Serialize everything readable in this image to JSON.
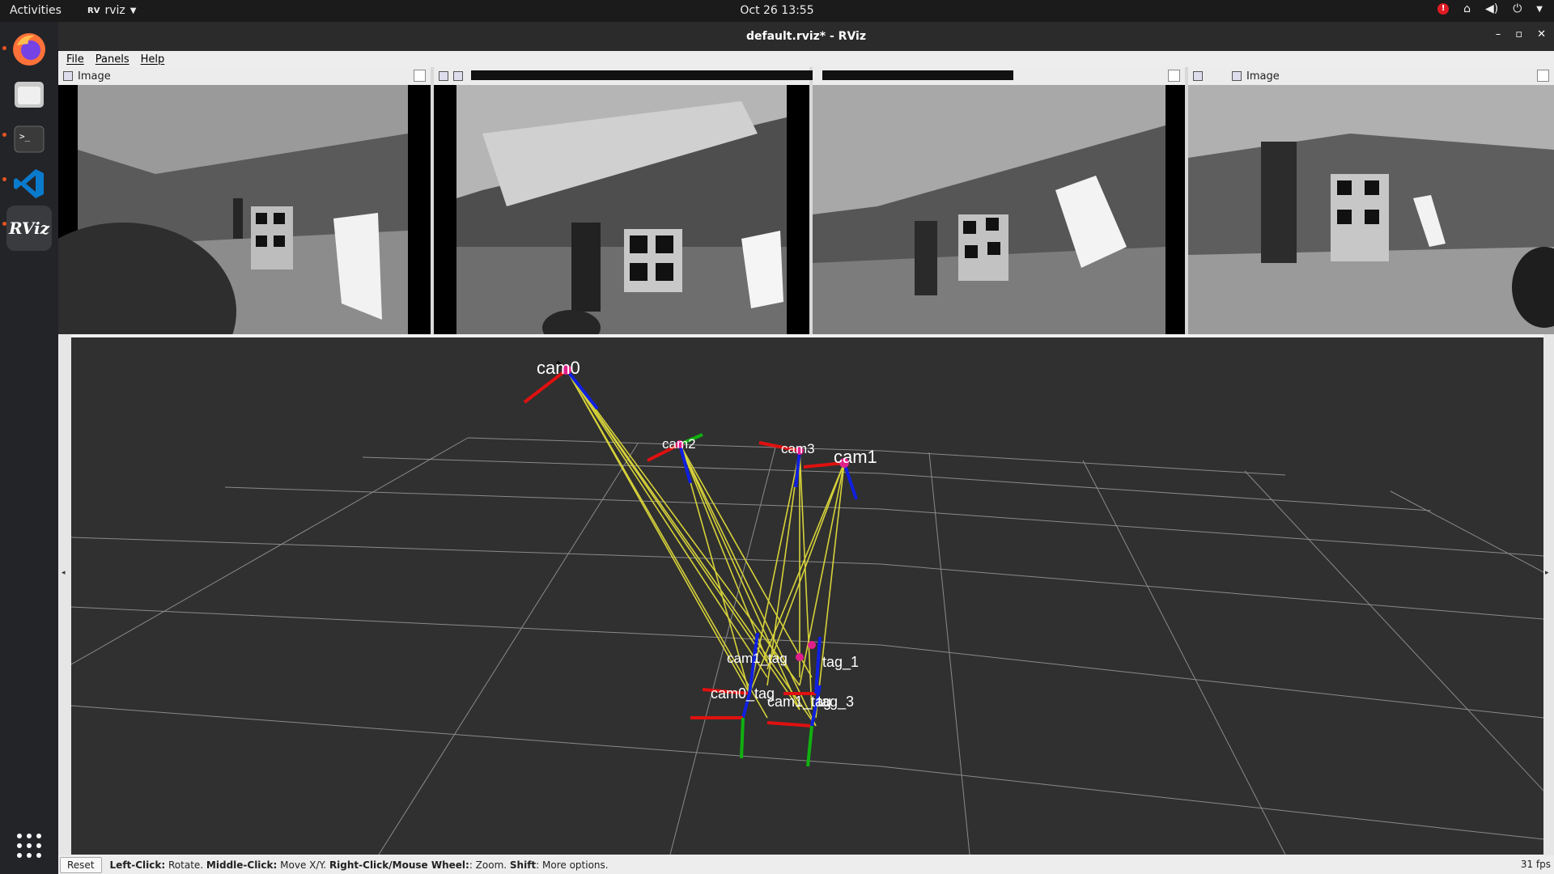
{
  "topbar": {
    "activities": "Activities",
    "app_name": "rviz",
    "clock": "Oct 26  13:55"
  },
  "window": {
    "title": "default.rviz* - RViz"
  },
  "menu": {
    "file": "File",
    "panels": "Panels",
    "help": "Help"
  },
  "image_panels": [
    {
      "title": "Image"
    },
    {
      "title": ""
    },
    {
      "title": ""
    },
    {
      "title": "Image"
    }
  ],
  "viewport": {
    "labels": {
      "cam0": "cam0",
      "cam1": "cam1",
      "cam2": "cam2",
      "cam3": "cam3",
      "tag_1": "tag_1",
      "tag_3": "tag_3",
      "cam0_tag": "cam0_tag",
      "cam1_tag": "cam1_tag"
    }
  },
  "statusbar": {
    "reset": "Reset",
    "hint_left_key": "Left-Click:",
    "hint_left": " Rotate. ",
    "hint_middle_key": "Middle-Click:",
    "hint_middle": " Move X/Y. ",
    "hint_right_key": "Right-Click/Mouse Wheel:",
    "hint_right": ": Zoom. ",
    "hint_shift_key": "Shift",
    "hint_shift": ": More options.",
    "fps": "31 fps"
  },
  "colors": {
    "accent": "#e95420",
    "viewport_bg": "#303030",
    "grid": "#9a9a9a",
    "ray": "#d6d23a",
    "axis_x": "#e01010",
    "axis_y": "#10b010",
    "axis_z": "#1020e0",
    "frame_marker": "#e0208a"
  }
}
